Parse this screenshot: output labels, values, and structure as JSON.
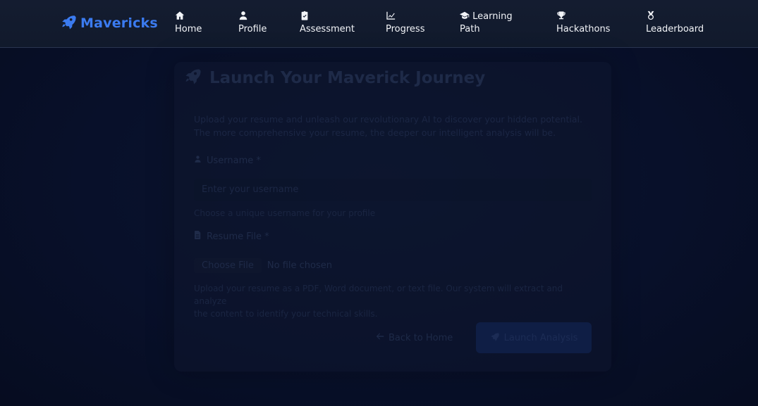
{
  "brand": {
    "name": "Mavericks",
    "icon": "rocket-icon",
    "color": "#3b7bf0"
  },
  "nav": {
    "items": [
      {
        "label": "Home",
        "icon": "home-icon"
      },
      {
        "label": "Profile",
        "icon": "user-icon"
      },
      {
        "label": "Assessment",
        "icon": "clipboard-check-icon"
      },
      {
        "label": "Progress",
        "icon": "chart-line-icon"
      },
      {
        "label_line1": "Learning",
        "label_line2": "Path",
        "icon": "graduation-cap-icon"
      },
      {
        "label": "Hackathons",
        "icon": "trophy-icon"
      },
      {
        "label": "Leaderboard",
        "icon": "medal-icon"
      }
    ]
  },
  "card": {
    "title": "Launch Your Maverick Journey",
    "intro_line1": "Upload your resume and unleash our revolutionary AI to discover your hidden potential.",
    "intro_line2": "The more comprehensive your resume, the deeper our intelligent analysis will be.",
    "username_label": "Username *",
    "username_placeholder": "Enter your username",
    "username_hint": "Choose a unique username for your profile",
    "resume_label": "Resume File *",
    "file_button": "Choose File",
    "file_status": "No file chosen",
    "resume_hint_line1": "Upload your resume as a PDF, Word document, or text file. Our system will extract and analyze",
    "resume_hint_line2": "the content to identify your technical skills.",
    "back_button": "Back to Home",
    "launch_button": "Launch Analysis"
  }
}
